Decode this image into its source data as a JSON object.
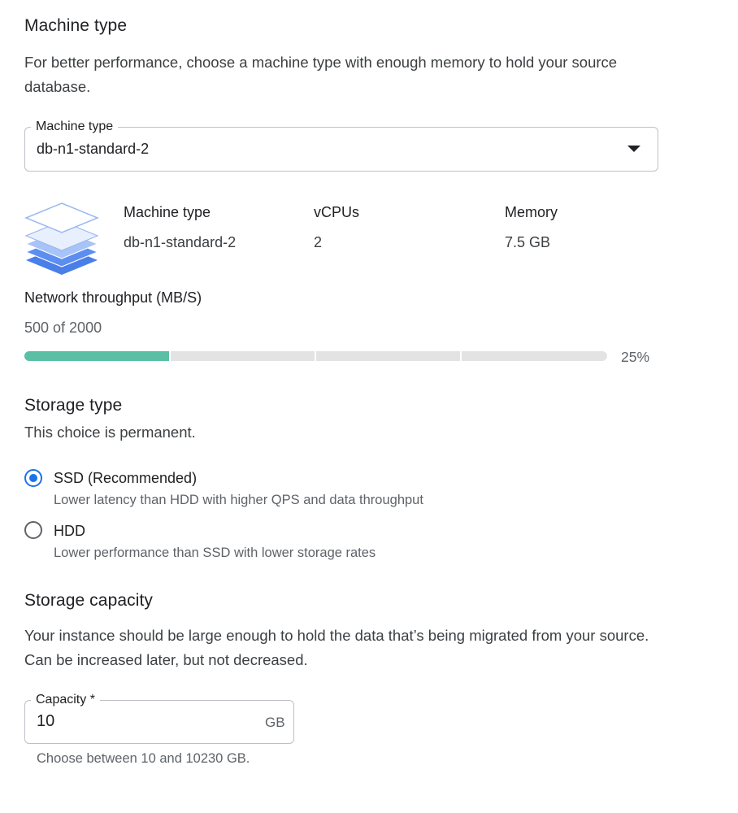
{
  "machine_section": {
    "title": "Machine type",
    "description": "For better performance, choose a machine type with enough memory to hold your source database.",
    "select": {
      "label": "Machine type",
      "value": "db-n1-standard-2"
    },
    "details": {
      "icon": "layers-icon",
      "headers": {
        "machine_type": "Machine type",
        "vcpus": "vCPUs",
        "memory": "Memory"
      },
      "values": {
        "machine_type": "db-n1-standard-2",
        "vcpus": "2",
        "memory": "7.5 GB"
      }
    }
  },
  "throughput": {
    "title": "Network throughput (MB/S)",
    "summary": "500 of 2000",
    "percent_label": "25%",
    "fill_fraction": 0.25,
    "fill_color": "#5bbfa5",
    "track_color": "#e3e3e3"
  },
  "storage_type": {
    "title": "Storage type",
    "subtitle": "This choice is permanent.",
    "options": [
      {
        "label": "SSD (Recommended)",
        "description": "Lower latency than HDD with higher QPS and data throughput",
        "selected": true
      },
      {
        "label": "HDD",
        "description": "Lower performance than SSD with lower storage rates",
        "selected": false
      }
    ]
  },
  "storage_capacity": {
    "title": "Storage capacity",
    "description": "Your instance should be large enough to hold the data that’s being migrated from your source. Can be increased later, but not decreased.",
    "input": {
      "label": "Capacity *",
      "value": "10",
      "suffix": "GB"
    },
    "helper": "Choose between 10 and 10230 GB."
  },
  "colors": {
    "accent": "#1a73e8",
    "progress": "#5bbfa5"
  }
}
